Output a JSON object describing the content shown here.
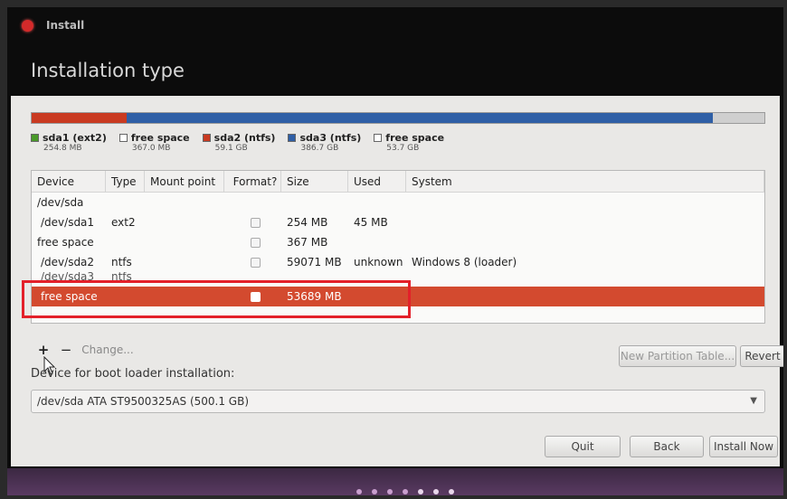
{
  "window": {
    "title": "Install"
  },
  "page": {
    "title": "Installation type"
  },
  "legend": [
    {
      "name": "sda1 (ext2)",
      "size": "254.8 MB",
      "color": "#4a9a2a"
    },
    {
      "name": "free space",
      "size": "367.0 MB",
      "color": "#ffffff"
    },
    {
      "name": "sda2 (ntfs)",
      "size": "59.1 GB",
      "color": "#c93a21"
    },
    {
      "name": "sda3 (ntfs)",
      "size": "386.7 GB",
      "color": "#2f5fa6"
    },
    {
      "name": "free space",
      "size": "53.7 GB",
      "color": "#ffffff"
    }
  ],
  "table": {
    "headers": [
      "Device",
      "Type",
      "Mount point",
      "Format?",
      "Size",
      "Used",
      "System"
    ],
    "rows": [
      {
        "device": "/dev/sda",
        "type": "",
        "mount": "",
        "size": "",
        "used": "",
        "system": ""
      },
      {
        "device": "/dev/sda1",
        "type": "ext2",
        "mount": "",
        "size": "254 MB",
        "used": "45 MB",
        "system": ""
      },
      {
        "device": "free space",
        "type": "",
        "mount": "",
        "size": "367 MB",
        "used": "",
        "system": ""
      },
      {
        "device": "/dev/sda2",
        "type": "ntfs",
        "mount": "",
        "size": "59071 MB",
        "used": "unknown",
        "system": "Windows 8 (loader)"
      },
      {
        "device": "/dev/sda3",
        "type": "ntfs",
        "mount": "",
        "size": "",
        "used": "",
        "system": ""
      },
      {
        "device": "free space",
        "type": "",
        "mount": "",
        "size": "53689 MB",
        "used": "",
        "system": ""
      }
    ]
  },
  "controls": {
    "add": "+",
    "remove": "−",
    "change": "Change...",
    "new_table": "New Partition Table...",
    "revert": "Revert"
  },
  "boot": {
    "label": "Device for boot loader installation:",
    "value": "/dev/sda   ATA ST9500325AS (500.1 GB)"
  },
  "buttons": {
    "quit": "Quit",
    "back": "Back",
    "install": "Install Now"
  },
  "colors": {
    "accent": "#d34a2f",
    "highlight": "#e3202a"
  }
}
